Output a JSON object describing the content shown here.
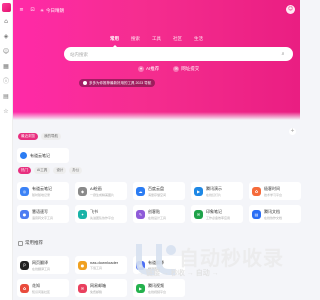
{
  "topnav": {
    "weather_city": "",
    "weather_text": "今日晴朗"
  },
  "search": {
    "tabs": [
      "常用",
      "搜索",
      "工具",
      "社区",
      "生活"
    ],
    "placeholder": "站内搜索"
  },
  "hot": [
    {
      "icon": "bulb-icon",
      "label": "AI推荐"
    },
    {
      "icon": "chat-icon",
      "label": "网址提交"
    }
  ],
  "notice": {
    "text": "多多为你推荐最新好用的工具 2023 导航"
  },
  "section_tabs": [
    "最近浏览",
    "我的导航"
  ],
  "recent": [
    {
      "title": "有道云笔记",
      "color": "#2b7cf3"
    }
  ],
  "sub_tabs": [
    "热门",
    "AI工具",
    "设计",
    "办公"
  ],
  "sites": [
    {
      "title": "有道云笔记",
      "desc": "随时随地记录",
      "color": "#3b82f6",
      "glyph": "◎"
    },
    {
      "title": "AI绘画",
      "desc": "一键生成精美图片",
      "color": "#8a8a8a",
      "glyph": "◆"
    },
    {
      "title": "百度云盘",
      "desc": "海量存储空间",
      "color": "#2b7cf3",
      "glyph": "☁"
    },
    {
      "title": "腾讯演示",
      "desc": "在线幻灯片",
      "color": "#1e88e5",
      "glyph": "▶"
    },
    {
      "title": "极客时间",
      "desc": "技术学习平台",
      "color": "#f56b3a",
      "glyph": "✿"
    },
    {
      "title": "慧语速写",
      "desc": "语音转文字工具",
      "color": "#4d7cf2",
      "glyph": "●"
    },
    {
      "title": "飞书",
      "desc": "先进团队协作平台",
      "color": "#19b3a8",
      "glyph": "✦"
    },
    {
      "title": "创客贴",
      "desc": "在线设计工具",
      "color": "#8f5bd9",
      "glyph": "✎"
    },
    {
      "title": "印象笔记",
      "desc": "工作必备效率应用",
      "color": "#1fa34a",
      "glyph": "✉"
    },
    {
      "title": "腾讯文档",
      "desc": "在线协作文档",
      "color": "#2a6ef5",
      "glyph": "▤"
    }
  ],
  "section2": {
    "title": "常用推荐"
  },
  "sites2": [
    {
      "title": "网页翻译",
      "desc": "在线翻译工具",
      "color": "#222222",
      "glyph": "P"
    },
    {
      "title": "nas.downloader",
      "desc": "下载工具",
      "color": "#f0a020",
      "glyph": "●"
    },
    {
      "title": "有道翻译",
      "desc": "翻译查词",
      "color": "#4b6ef5",
      "glyph": "▣"
    },
    {
      "title": "",
      "desc": "",
      "color": "#ffffff",
      "glyph": ""
    },
    {
      "title": "",
      "desc": "",
      "color": "#ffffff",
      "glyph": ""
    },
    {
      "title": "花知",
      "desc": "知识问答社区",
      "color": "#e94b3c",
      "glyph": "✿"
    },
    {
      "title": "网易邮箱",
      "desc": "免费邮箱",
      "color": "#e9405e",
      "glyph": "✉"
    },
    {
      "title": "腾讯视频",
      "desc": "在线视频平台",
      "color": "#23b14d",
      "glyph": "▶"
    }
  ],
  "watermark": {
    "title": "自动秒收录",
    "sub": "→ 链接 → 秒收 → 自动 →"
  }
}
